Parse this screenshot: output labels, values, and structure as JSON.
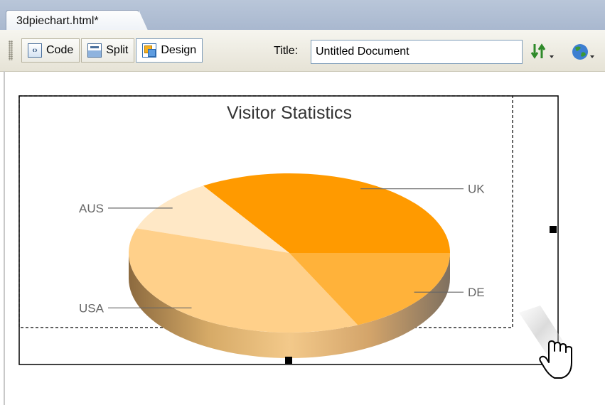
{
  "document_tab": {
    "label": "3dpiechart.html*"
  },
  "toolbar": {
    "code_label": "Code",
    "split_label": "Split",
    "design_label": "Design",
    "title_label": "Title:",
    "title_value": "Untitled Document"
  },
  "chart_data": {
    "type": "pie",
    "title": "Visitor Statistics",
    "series": [
      {
        "name": "UK",
        "value": 34,
        "color": "#ff9a00"
      },
      {
        "name": "AUS",
        "value": 11,
        "color": "#ffe8c6"
      },
      {
        "name": "USA",
        "value": 37,
        "color": "#ffd08a"
      },
      {
        "name": "DE",
        "value": 18,
        "color": "#ffb23a"
      }
    ],
    "style": "3d"
  }
}
